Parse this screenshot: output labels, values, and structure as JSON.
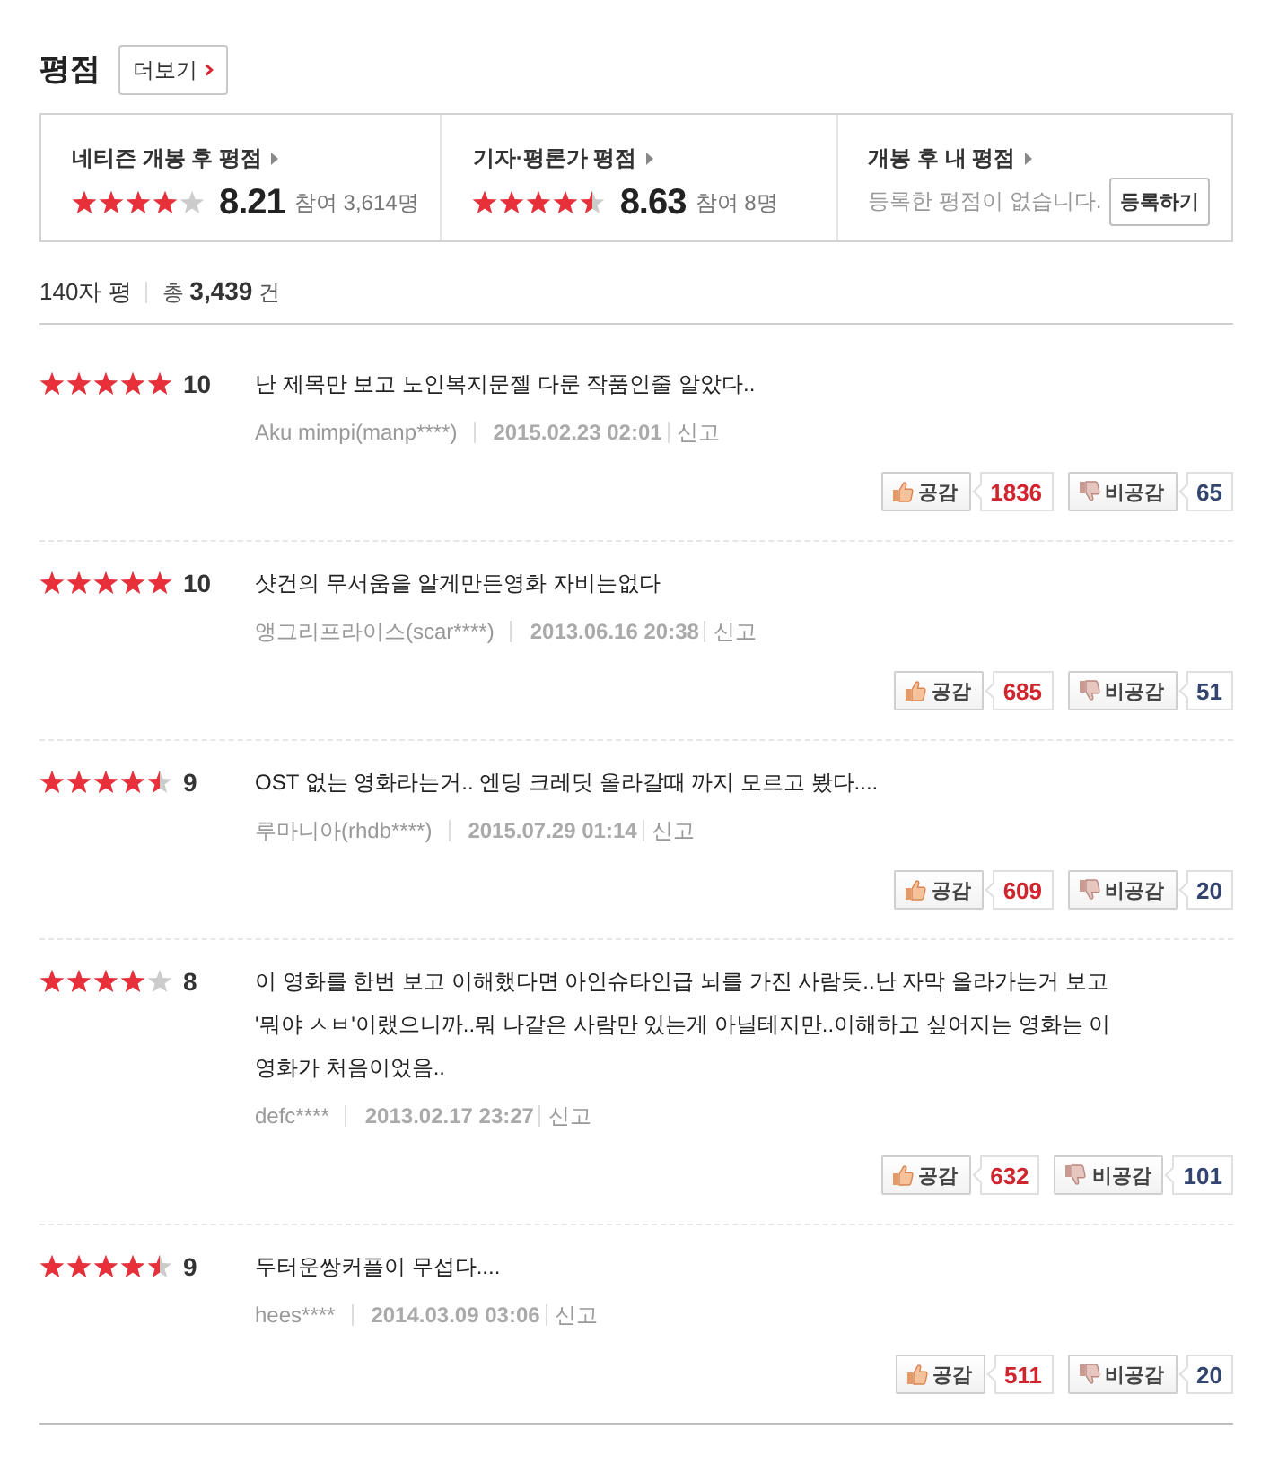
{
  "header": {
    "title": "평점",
    "more_button": "더보기"
  },
  "summary": [
    {
      "kind": "rating",
      "title": "네티즌 개봉 후 평점",
      "stars": 4,
      "score": "8.21",
      "participants": "참여 3,614명"
    },
    {
      "kind": "rating",
      "title": "기자·평론가 평점",
      "stars": 4.5,
      "score": "8.63",
      "participants": "참여 8명"
    },
    {
      "kind": "mine",
      "title": "개봉 후 내 평점",
      "message": "등록한 평점이 없습니다.",
      "button": "등록하기"
    }
  ],
  "reviews_header": {
    "label": "140자 평",
    "total": "총 **3,439** 건"
  },
  "reviews": [
    {
      "stars": 5,
      "score": "10",
      "text": "난 제목만 보고 노인복지문젤 다룬 작품인줄 알았다..",
      "author": "Aku mimpi(manp****)",
      "date": "2015.02.23 02:01",
      "report": "신고",
      "like_label": "공감",
      "likes": "1836",
      "dislike_label": "비공감",
      "dislikes": "65"
    },
    {
      "stars": 5,
      "score": "10",
      "text": "샷건의 무서움을 알게만든영화 자비는없다",
      "author": "앵그리프라이스(scar****)",
      "date": "2013.06.16 20:38",
      "report": "신고",
      "like_label": "공감",
      "likes": "685",
      "dislike_label": "비공감",
      "dislikes": "51"
    },
    {
      "stars": 4.5,
      "score": "9",
      "text": "OST 없는 영화라는거.. 엔딩 크레딧 올라갈때 까지 모르고 봤다....",
      "author": "루마니아(rhdb****)",
      "date": "2015.07.29 01:14",
      "report": "신고",
      "like_label": "공감",
      "likes": "609",
      "dislike_label": "비공감",
      "dislikes": "20"
    },
    {
      "stars": 4,
      "score": "8",
      "text": "이 영화를 한번 보고 이해했다면 아인슈타인급 뇌를 가진 사람듯..난 자막 올라가는거 보고 '뭐야 ㅅㅂ'이랬으니까..뭐 나같은 사람만 있는게 아닐테지만..이해하고 싶어지는 영화는 이 영화가 처음이었음..",
      "author": "defc****",
      "date": "2013.02.17 23:27",
      "report": "신고",
      "like_label": "공감",
      "likes": "632",
      "dislike_label": "비공감",
      "dislikes": "101"
    },
    {
      "stars": 4.5,
      "score": "9",
      "text": "두터운쌍커플이 무섭다....",
      "author": "hees****",
      "date": "2014.03.09 03:06",
      "report": "신고",
      "like_label": "공감",
      "likes": "511",
      "dislike_label": "비공감",
      "dislikes": "20"
    }
  ]
}
